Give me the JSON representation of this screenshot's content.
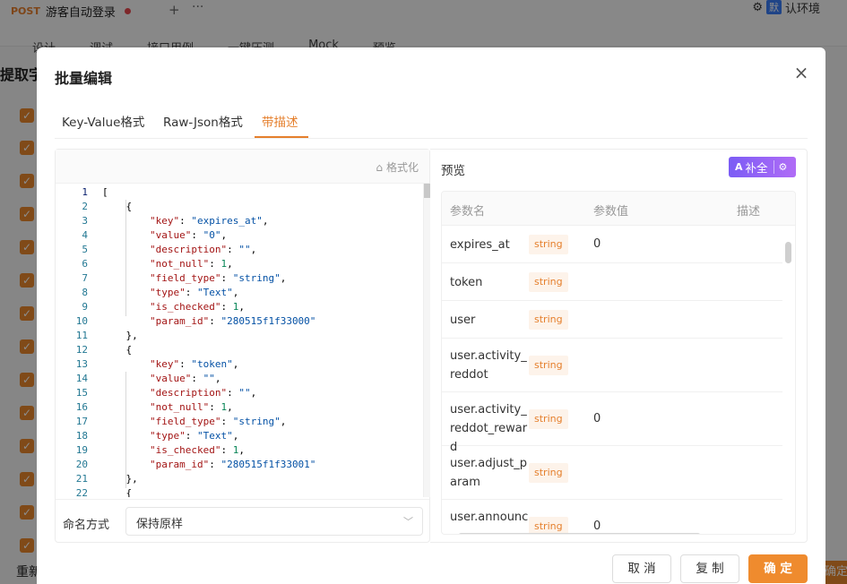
{
  "background": {
    "request_tab": {
      "method": "POST",
      "title": "游客自动登录"
    },
    "env_badge": "默",
    "env_label": "认环境",
    "sub_nav": [
      "设计",
      "调试",
      "接口用例",
      "一键压测",
      "Mock",
      "预览"
    ],
    "left_title": "提取字",
    "reset_label": "重新",
    "right_button": "确定"
  },
  "modal": {
    "title": "批量编辑",
    "close_icon": "×",
    "tabs": [
      {
        "label": "Key-Value格式"
      },
      {
        "label": "Raw-Json格式"
      },
      {
        "label": "带描述"
      }
    ],
    "active_tab": 2,
    "editor": {
      "format_label": "格式化",
      "lines": [
        "[",
        "    {",
        "        \"key\": \"expires_at\",",
        "        \"value\": \"0\",",
        "        \"description\": \"\",",
        "        \"not_null\": 1,",
        "        \"field_type\": \"string\",",
        "        \"type\": \"Text\",",
        "        \"is_checked\": 1,",
        "        \"param_id\": \"280515f1f33000\"",
        "    },",
        "    {",
        "        \"key\": \"token\",",
        "        \"value\": \"\",",
        "        \"description\": \"\",",
        "        \"not_null\": 1,",
        "        \"field_type\": \"string\",",
        "        \"type\": \"Text\",",
        "        \"is_checked\": 1,",
        "        \"param_id\": \"280515f1f33001\"",
        "    },",
        "    {"
      ]
    },
    "naming": {
      "label": "命名方式",
      "value": "保持原样"
    },
    "preview": {
      "title": "预览",
      "ai_button": {
        "icon": "A",
        "label": "补全"
      },
      "columns": [
        "参数名",
        "参数值",
        "描述"
      ],
      "rows": [
        {
          "name": "expires_at",
          "type": "string",
          "value": "0"
        },
        {
          "name": "token",
          "type": "string",
          "value": ""
        },
        {
          "name": "user",
          "type": "string",
          "value": ""
        },
        {
          "name": "user.activity_reddot",
          "type": "string",
          "value": ""
        },
        {
          "name": "user.activity_reddot_reward",
          "type": "string",
          "value": "0"
        },
        {
          "name": "user.adjust_param",
          "type": "string",
          "value": ""
        },
        {
          "name": "user.announc",
          "type": "string",
          "value": "0"
        }
      ]
    },
    "buttons": {
      "cancel": "取 消",
      "copy": "复 制",
      "ok": "确 定"
    }
  }
}
